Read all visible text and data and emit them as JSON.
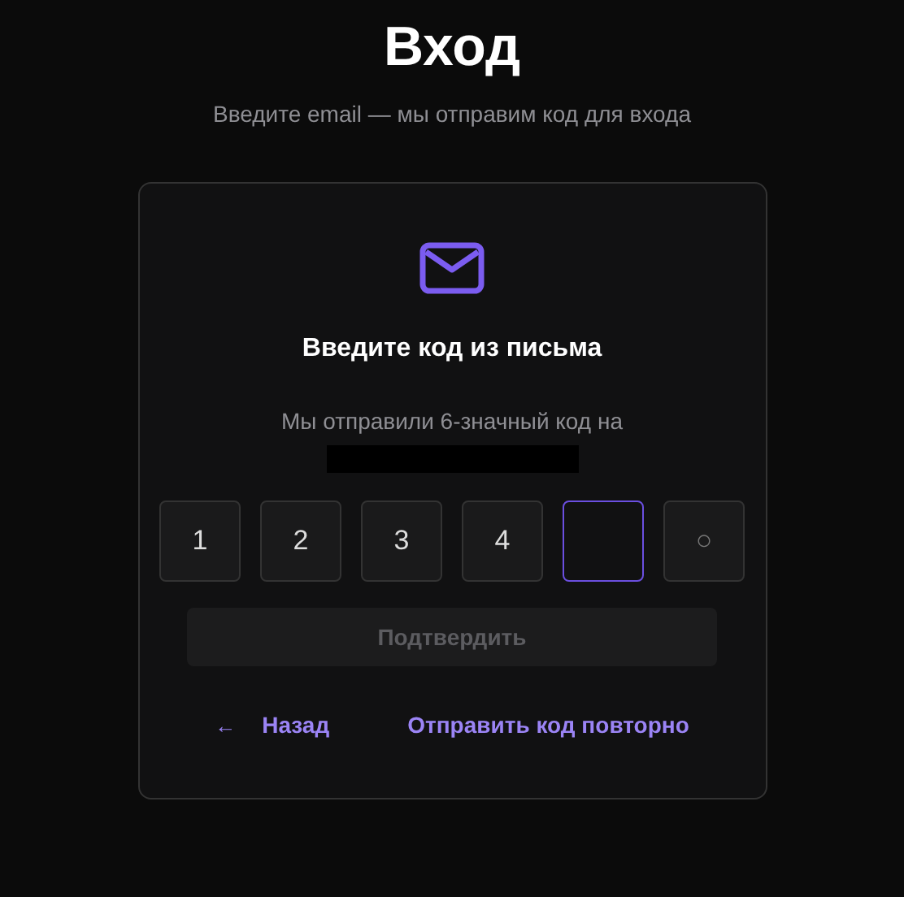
{
  "page": {
    "title": "Вход",
    "subtitle": "Введите email — мы отправим код для входа"
  },
  "card": {
    "heading": "Введите код из письма",
    "message": "Мы отправили 6-значный код на",
    "code_cells": [
      {
        "value": "1",
        "focused": false
      },
      {
        "value": "2",
        "focused": false
      },
      {
        "value": "3",
        "focused": false
      },
      {
        "value": "4",
        "focused": false
      },
      {
        "focused": true
      },
      {
        "placeholder": "○",
        "focused": false
      }
    ],
    "submit": {
      "label": "Подтвердить",
      "disabled": true
    },
    "back_link": {
      "icon": "←",
      "label": "Назад"
    },
    "resend_link": {
      "label": "Отправить код повторно"
    }
  }
}
